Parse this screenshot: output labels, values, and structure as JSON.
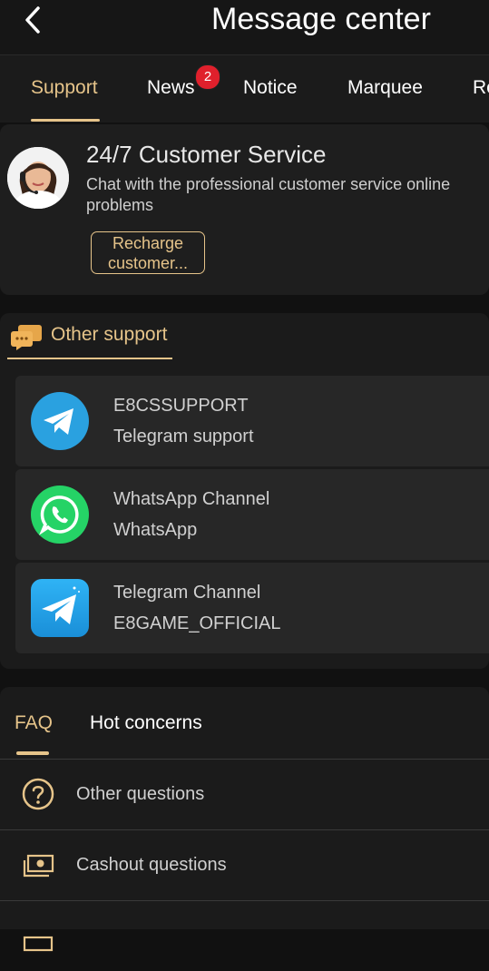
{
  "header": {
    "title": "Message center"
  },
  "tabs": [
    {
      "label": "Support"
    },
    {
      "label": "News",
      "badge": "2"
    },
    {
      "label": "Notice"
    },
    {
      "label": "Marquee"
    },
    {
      "label": "Re"
    }
  ],
  "customer_service": {
    "title": "24/7 Customer Service",
    "description": "Chat with the professional customer service online problems",
    "button_label": "Recharge customer..."
  },
  "other_support": {
    "title": "Other support",
    "items": [
      {
        "name": "E8CSSUPPORT",
        "sub": "Telegram support",
        "icon": "telegram-icon"
      },
      {
        "name": "WhatsApp Channel",
        "sub": "WhatsApp",
        "icon": "whatsapp-icon"
      },
      {
        "name": "Telegram Channel",
        "sub": "E8GAME_OFFICIAL",
        "icon": "telegram-channel-icon"
      }
    ]
  },
  "faq": {
    "tabs": [
      {
        "label": "FAQ"
      },
      {
        "label": "Hot concerns"
      }
    ],
    "items": [
      {
        "label": "Other questions",
        "icon": "question-icon"
      },
      {
        "label": "Cashout questions",
        "icon": "cash-icon"
      }
    ]
  },
  "colors": {
    "background": "#111111",
    "accent_gold": "#e6c48a",
    "badge_red": "#e0202c",
    "telegram_blue": "#2aa1e0",
    "whatsapp_green": "#25d366"
  }
}
